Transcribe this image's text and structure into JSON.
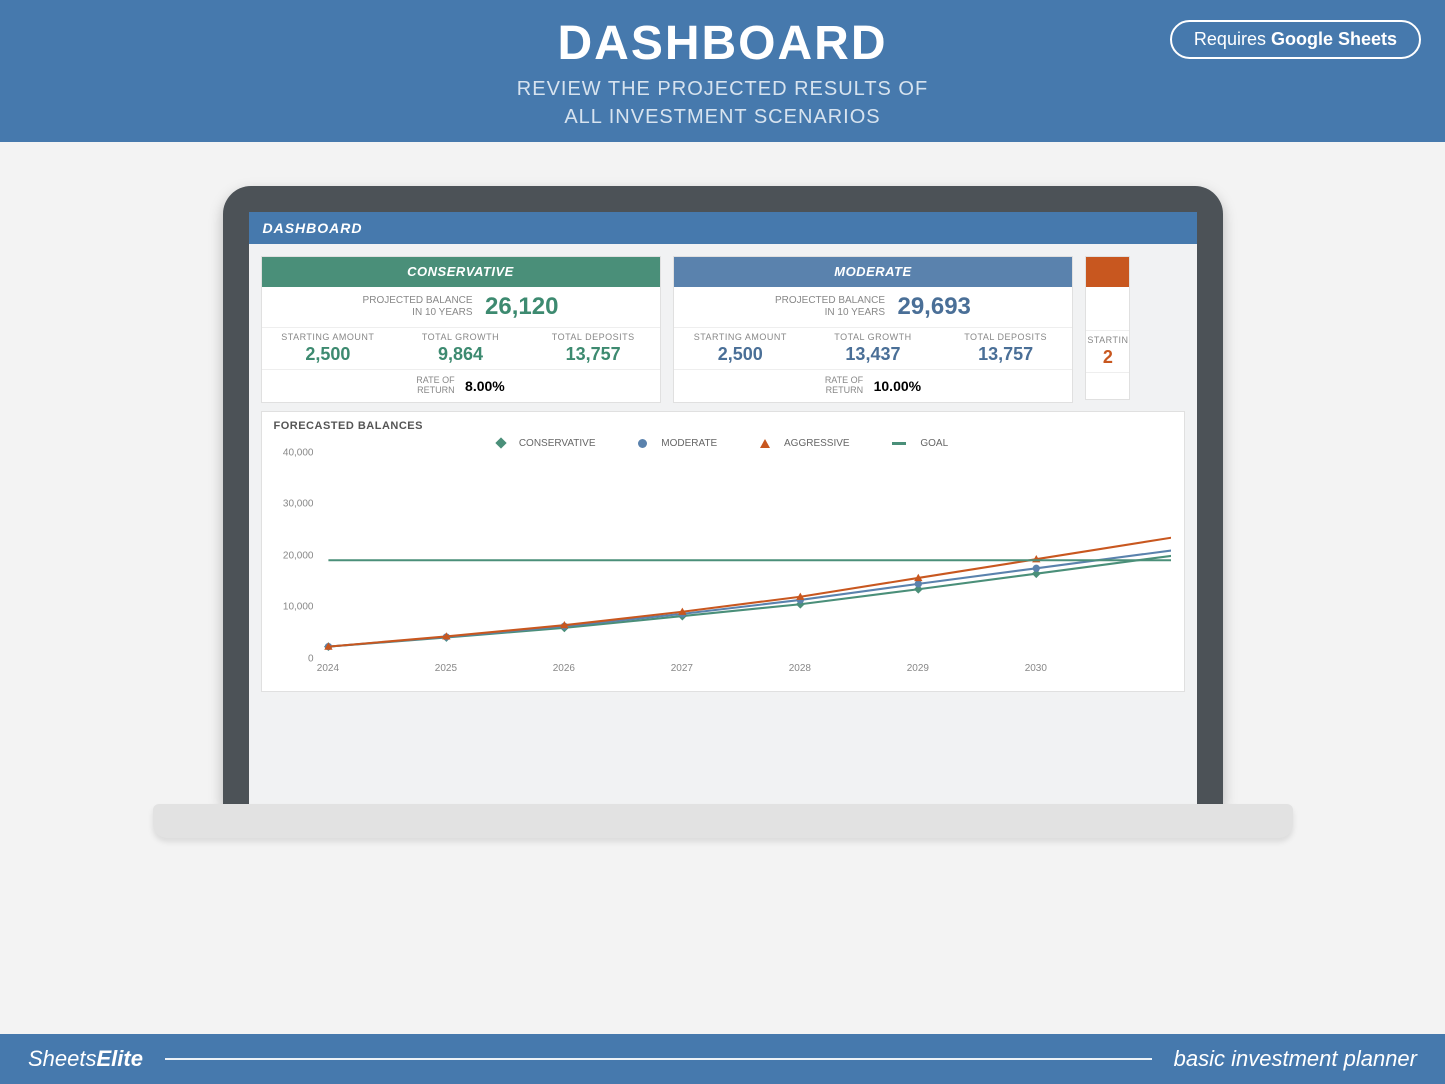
{
  "banner": {
    "title": "DASHBOARD",
    "subtitle_l1": "REVIEW THE PROJECTED RESULTS OF",
    "subtitle_l2": "ALL INVESTMENT SCENARIOS",
    "requires_prefix": "Requires ",
    "requires_bold": "Google Sheets"
  },
  "dashboard": {
    "header": "DASHBOARD",
    "proj_label_l1": "PROJECTED BALANCE",
    "proj_label_l2": "IN 10 YEARS",
    "labels": {
      "starting": "STARTING AMOUNT",
      "growth": "TOTAL GROWTH",
      "deposits": "TOTAL DEPOSITS",
      "ror_l1": "RATE OF",
      "ror_l2": "RETURN"
    },
    "scenarios": [
      {
        "name": "CONSERVATIVE",
        "projected": "26,120",
        "starting": "2,500",
        "growth": "9,864",
        "deposits": "13,757",
        "ror": "8.00%"
      },
      {
        "name": "MODERATE",
        "projected": "29,693",
        "starting": "2,500",
        "growth": "13,437",
        "deposits": "13,757",
        "ror": "10.00%"
      }
    ],
    "aggressive_peek": {
      "starting_label": "STARTIN",
      "starting_val": "2"
    }
  },
  "chart": {
    "title": "FORECASTED BALANCES",
    "legend": {
      "conservative": "CONSERVATIVE",
      "moderate": "MODERATE",
      "aggressive": "AGGRESSIVE",
      "goal": "GOAL"
    }
  },
  "chart_data": {
    "type": "line",
    "title": "FORECASTED BALANCES",
    "xlabel": "",
    "ylabel": "",
    "ylim": [
      0,
      40000
    ],
    "y_ticks": [
      0,
      10000,
      20000,
      30000,
      40000
    ],
    "y_tick_labels": [
      "0",
      "10,000",
      "20,000",
      "30,000",
      "40,000"
    ],
    "categories": [
      "2024",
      "2025",
      "2026",
      "2027",
      "2028",
      "2029",
      "2030"
    ],
    "goal": 20000,
    "series": [
      {
        "name": "CONSERVATIVE",
        "color": "#4a8f79",
        "values": [
          3900,
          5600,
          7400,
          9600,
          11800,
          14600,
          17500
        ]
      },
      {
        "name": "MODERATE",
        "color": "#5a82ad",
        "values": [
          3900,
          5700,
          7700,
          10000,
          12600,
          15600,
          18500
        ]
      },
      {
        "name": "AGGRESSIVE",
        "color": "#c8571f",
        "values": [
          3900,
          5800,
          7900,
          10400,
          13200,
          16700,
          20200
        ]
      },
      {
        "name": "GOAL",
        "color": "#4a8f79",
        "values": [
          20000,
          20000,
          20000,
          20000,
          20000,
          20000,
          20000
        ]
      }
    ]
  },
  "footer": {
    "brand_light": "Sheets",
    "brand_bold": "Elite",
    "product": "basic investment planner"
  }
}
